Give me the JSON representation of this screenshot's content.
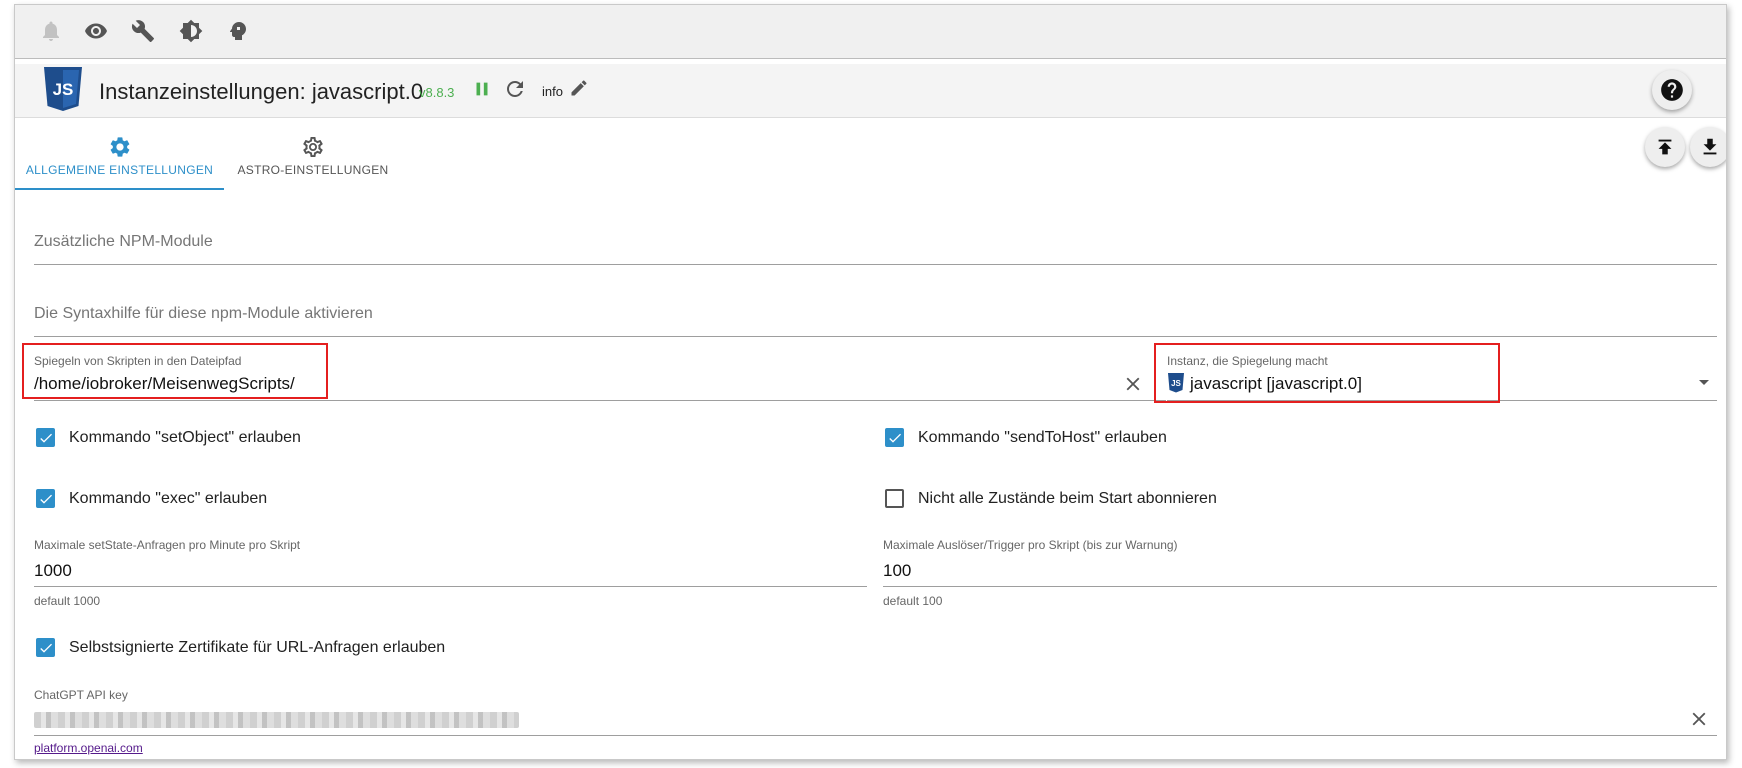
{
  "topbar": {
    "icons": [
      "bell-icon",
      "eye-icon",
      "wrench-icon",
      "brightness-icon",
      "head-icon"
    ]
  },
  "header": {
    "logo_text": "JS",
    "title": "Instanzeinstellungen: javascript.0",
    "version": "v8.8.3",
    "info_label": "info"
  },
  "tabs": [
    {
      "label": "ALLGEMEINE EINSTELLUNGEN",
      "active": true
    },
    {
      "label": "ASTRO-EINSTELLUNGEN",
      "active": false
    }
  ],
  "form": {
    "npm_modules_placeholder": "Zusätzliche NPM-Module",
    "syntax_help_placeholder": "Die Syntaxhilfe für diese npm-Module aktivieren",
    "mirror_path": {
      "label": "Spiegeln von Skripten in den Dateipfad",
      "value": "/home/iobroker/MeisenwegScripts/"
    },
    "mirror_instance": {
      "label": "Instanz, die Spiegelung macht",
      "value": "javascript [javascript.0]"
    },
    "checkboxes": {
      "set_object": {
        "label": "Kommando \"setObject\" erlauben",
        "checked": true
      },
      "send_to_host": {
        "label": "Kommando \"sendToHost\" erlauben",
        "checked": true
      },
      "exec": {
        "label": "Kommando \"exec\" erlauben",
        "checked": true
      },
      "no_subscribe": {
        "label": "Nicht alle Zustände beim Start abonnieren",
        "checked": false
      },
      "self_signed": {
        "label": "Selbstsignierte Zertifikate für URL-Anfragen erlauben",
        "checked": true
      }
    },
    "max_setstate": {
      "label": "Maximale setState-Anfragen pro Minute pro Skript",
      "value": "1000",
      "helper": "default 1000"
    },
    "max_triggers": {
      "label": "Maximale Auslöser/Trigger pro Skript (bis zur Warnung)",
      "value": "100",
      "helper": "default 100"
    },
    "chatgpt": {
      "label": "ChatGPT API key",
      "link": "platform.openai.com"
    }
  },
  "colors": {
    "accent": "#2d8fc9",
    "running": "#4caf50",
    "highlight": "#e41f1f",
    "js_logo": "#1e4d8c"
  }
}
